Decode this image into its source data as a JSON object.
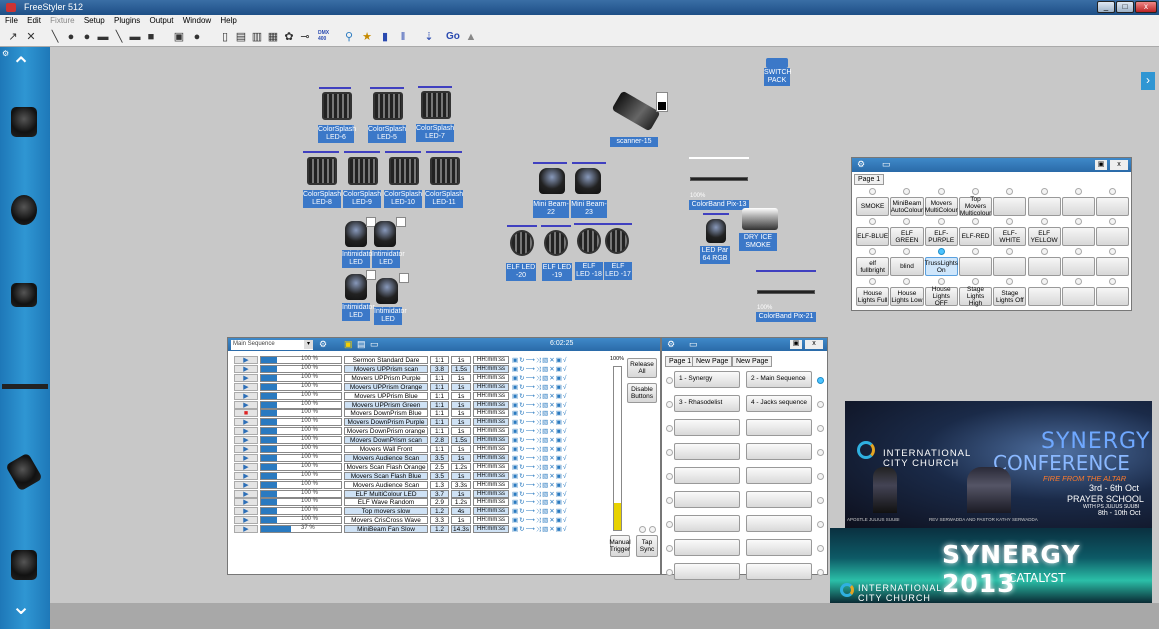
{
  "app": {
    "title": "FreeStyler 512",
    "min": "_",
    "max": "□",
    "close": "x"
  },
  "menu": [
    "File",
    "Edit",
    "Fixture",
    "Setup",
    "Plugins",
    "Output",
    "Window",
    "Help"
  ],
  "toolbar": {
    "dmx_label": "DMX 400",
    "go_label": "Go"
  },
  "fixtures": {
    "top_right": "SWITCH PACK",
    "par_row1": [
      "ColorSplash LED-6",
      "ColorSplash LED-5",
      "ColorSplash LED-7"
    ],
    "par_row2": [
      "ColorSplash LED-8",
      "ColorSplash LED-9",
      "ColorSplash LED-10",
      "ColorSplash LED-11"
    ],
    "movers": [
      "Intimidator LED",
      "Intimidator LED",
      "Intimidator LED",
      "Intimidator LED"
    ],
    "scanner": "scanner-15",
    "minibeam": [
      "Mini Beam-22",
      "Mini Beam-23"
    ],
    "elf": [
      "ELF LED -20",
      "ELF LED -19",
      "ELF LED -18",
      "ELF LED -17"
    ],
    "colorband1": "ColorBand Pix-13",
    "colorband1_pct": "100%",
    "ledpar": "LED Par 64 RGB",
    "smoke": "DRY ICE SMOKE",
    "colorband2": "ColorBand Pix-21",
    "colorband2_pct": "100%"
  },
  "submaster": {
    "tab": "Page 1",
    "buttons": [
      [
        "SMOKE",
        "MiniBeam AutoColour",
        "Movers MultiColour",
        "Top Movers Multicolour",
        "",
        "",
        "",
        ""
      ],
      [
        "ELF-BLUE",
        "ELF GREEN",
        "ELF-PURPLE",
        "ELF-RED",
        "ELF-WHITE",
        "ELF YELLOW",
        "",
        ""
      ],
      [
        "elf fullbright",
        "blind",
        "TrussLights On",
        "",
        "",
        "",
        "",
        ""
      ],
      [
        "House Lights Full",
        "House Lights Low",
        "House Lights OFF",
        "Stage Lights High",
        "Stage Lights Off",
        "",
        "",
        ""
      ]
    ]
  },
  "sequence": {
    "dropdown": "Main Sequence",
    "time": "6:02:25",
    "master_pct": "100%",
    "release_label": "Release All",
    "disable_label": "Disable Buttons",
    "manual_label": "Manual Trigger",
    "tap_label": "Tap Sync",
    "rows": [
      {
        "pct": "100 %",
        "fill": 1.0,
        "name": "Sermon Standard Dare",
        "a": "1:1",
        "b": "1s",
        "c": "HH:mm:ss",
        "stop": false
      },
      {
        "pct": "100 %",
        "fill": 1.0,
        "name": "Movers UPPrism scan",
        "a": "3.8",
        "b": "1.5s",
        "c": "HH:mm:ss",
        "stop": false
      },
      {
        "pct": "100 %",
        "fill": 1.0,
        "name": "Movers UPPrism Purple",
        "a": "1:1",
        "b": "1s",
        "c": "HH:mm:ss",
        "stop": false
      },
      {
        "pct": "100 %",
        "fill": 1.0,
        "name": "Movers UPPrism Orange",
        "a": "1:1",
        "b": "1s",
        "c": "HH:mm:ss",
        "stop": false
      },
      {
        "pct": "100 %",
        "fill": 1.0,
        "name": "Movers UPPrism Blue",
        "a": "1:1",
        "b": "1s",
        "c": "HH:mm:ss",
        "stop": false
      },
      {
        "pct": "100 %",
        "fill": 1.0,
        "name": "Movers UPPrism Green",
        "a": "1:1",
        "b": "1s",
        "c": "HH:mm:ss",
        "stop": false
      },
      {
        "pct": "100 %",
        "fill": 1.0,
        "name": "Movers DownPrism Blue",
        "a": "1:1",
        "b": "1s",
        "c": "HH:mm:ss",
        "stop": true
      },
      {
        "pct": "100 %",
        "fill": 1.0,
        "name": "Movers DownPrism Purple",
        "a": "1:1",
        "b": "1s",
        "c": "HH:mm:ss",
        "stop": false
      },
      {
        "pct": "100 %",
        "fill": 1.0,
        "name": "Movers DownPrism orange",
        "a": "1:1",
        "b": "1s",
        "c": "HH:mm:ss",
        "stop": false
      },
      {
        "pct": "100 %",
        "fill": 1.0,
        "name": "Movers DownPrism scan",
        "a": "2.8",
        "b": "1.5s",
        "c": "HH:mm:ss",
        "stop": false
      },
      {
        "pct": "100 %",
        "fill": 1.0,
        "name": "Movers Wall Front",
        "a": "1:1",
        "b": "1s",
        "c": "HH:mm:ss",
        "stop": false
      },
      {
        "pct": "100 %",
        "fill": 1.0,
        "name": "Movers Audience Scan",
        "a": "3.5",
        "b": "1s",
        "c": "HH:mm:ss",
        "stop": false
      },
      {
        "pct": "100 %",
        "fill": 1.0,
        "name": "Movers Scan Flash Orange",
        "a": "2.5",
        "b": "1.2s",
        "c": "HH:mm:ss",
        "stop": false
      },
      {
        "pct": "100 %",
        "fill": 1.0,
        "name": "Movers Scan Flash Blue",
        "a": "3.5",
        "b": "1s",
        "c": "HH:mm:ss",
        "stop": false
      },
      {
        "pct": "100 %",
        "fill": 1.0,
        "name": "Movers Audience Scan",
        "a": "1.3",
        "b": "3.3s",
        "c": "HH:mm:ss",
        "stop": false
      },
      {
        "pct": "100 %",
        "fill": 1.0,
        "name": "ELF MultiColour LED",
        "a": "3.7",
        "b": "1s",
        "c": "HH:mm:ss",
        "stop": false
      },
      {
        "pct": "100 %",
        "fill": 1.0,
        "name": "ELF Wave Random",
        "a": "2.9",
        "b": "1.2s",
        "c": "HH:mm:ss",
        "stop": false
      },
      {
        "pct": "100 %",
        "fill": 1.0,
        "name": "Top movers slow",
        "a": "1.2",
        "b": "4s",
        "c": "HH:mm:ss",
        "stop": false
      },
      {
        "pct": "100 %",
        "fill": 1.0,
        "name": "Movers CrisCross Wave",
        "a": "3.3",
        "b": "1s",
        "c": "HH:mm:ss",
        "stop": false
      },
      {
        "pct": "37 %",
        "fill": 0.37,
        "name": "MiniBeam Fan Slow",
        "a": "1.2",
        "b": "14.3s",
        "c": "HH:mm:ss",
        "stop": false
      }
    ]
  },
  "cues": {
    "tabs": [
      "Page 1",
      "New Page",
      "New Page"
    ],
    "buttons": [
      [
        "1 - Synergy",
        "2 - Main Sequence"
      ],
      [
        "3 - Rhasodelist",
        "4 - Jacks sequence"
      ],
      [
        "",
        ""
      ],
      [
        "",
        ""
      ],
      [
        "",
        ""
      ],
      [
        "",
        ""
      ],
      [
        "",
        ""
      ],
      [
        "",
        ""
      ],
      [
        "",
        ""
      ]
    ]
  },
  "banner1": {
    "church": "INTERNATIONAL CITY CHURCH",
    "title1": "SYNERGY",
    "title2": "CONFERENCE",
    "tagline": "FIRE FROM THE ALTAR",
    "dates": "3rd - 6th Oct",
    "prayer": "PRAYER SCHOOL",
    "with": "WITH PS JULIUS SUUBI",
    "pdates": "8th - 10th Oct",
    "apostle": "APOSTLE JULIUS SUUBI",
    "pastors": "REV SERWADDA AND PASTOR KATHY SERWADDA"
  },
  "banner2": {
    "title": "SYNERGY 2013",
    "sub": "CATALYST",
    "church": "INTERNATIONAL CITY CHURCH"
  },
  "colors": {
    "accent": "#2f96d3",
    "label": "#3b78c8"
  }
}
